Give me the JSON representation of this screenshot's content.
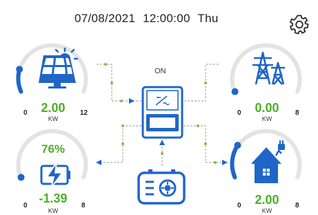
{
  "header": {
    "date": "07/08/2021",
    "time": "12:00:00",
    "weekday": "Thu"
  },
  "inverter": {
    "status": "ON"
  },
  "pv": {
    "value": "2.00",
    "unit": "KW",
    "min": "0",
    "max": "12",
    "level": 0.17
  },
  "grid": {
    "value": "0.00",
    "unit": "KW",
    "min": "0",
    "max": "8",
    "level": 0.0
  },
  "battery": {
    "soc": "76%",
    "value": "-1.39",
    "unit": "KW",
    "min": "0",
    "max": "8",
    "level": 0.0
  },
  "load": {
    "value": "2.00",
    "unit": "KW",
    "min": "0",
    "max": "8",
    "level": 0.25
  },
  "icons": [
    "solar-panel-icon",
    "transmission-tower-icon",
    "battery-charging-icon",
    "home-icon",
    "generator-icon",
    "inverter-icon",
    "gear-icon"
  ],
  "colors": {
    "accent": "#1f66c8",
    "value_green": "#4caf28",
    "flow_dot": "#7cc242",
    "gauge_track": "#e3e3e3"
  }
}
